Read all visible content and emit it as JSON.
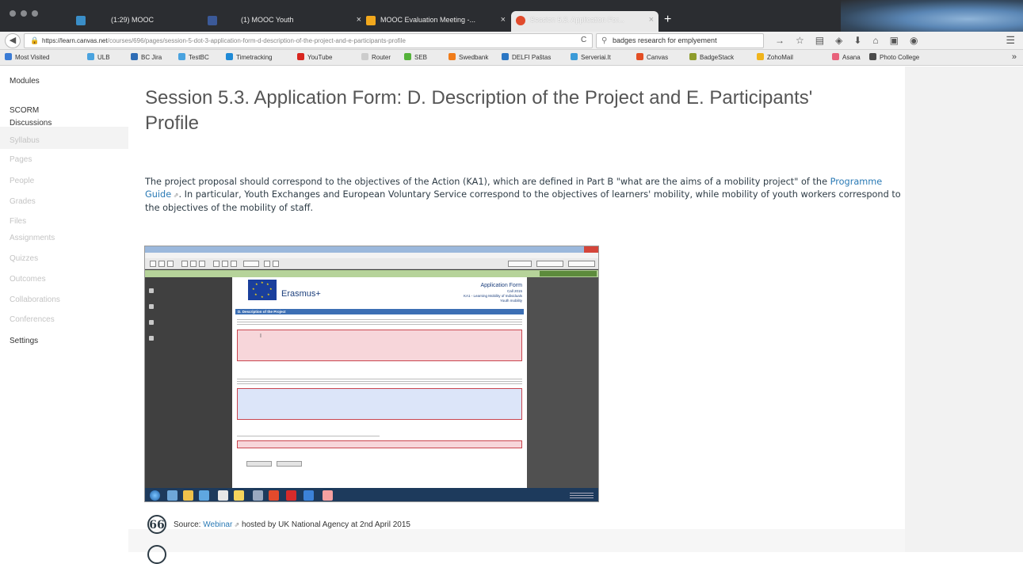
{
  "browser": {
    "tabs": [
      {
        "label": "(1:29) MOOC",
        "color": "#3a8ec8"
      },
      {
        "label": "(1) MOOC Youth",
        "color": "#3b5998"
      },
      {
        "label": "MOOC Evaluation Meeting -...",
        "color": "#f2a81d"
      },
      {
        "label": "Session 5.3. Application For...",
        "color": "#e14b2c"
      }
    ],
    "new_tab_label": "+",
    "url_host": "https://learn.canvas.net",
    "url_path": "/courses/696/pages/session-5-dot-3-application-form-d-description-of-the-project-and-e-participants-profile",
    "search_value": "badges research for emplyement",
    "bookmarks": [
      {
        "label": "Most Visited",
        "color": "#3a7bd5"
      },
      {
        "label": "ULB",
        "color": "#4aa3df"
      },
      {
        "label": "BC Jira",
        "color": "#2d6cb5"
      },
      {
        "label": "TestBC",
        "color": "#4aa3df"
      },
      {
        "label": "Timetracking",
        "color": "#1f8ad6"
      },
      {
        "label": "YouTube",
        "color": "#d8261f"
      },
      {
        "label": "Router",
        "color": "#cccccc"
      },
      {
        "label": "SEB",
        "color": "#55b33b"
      },
      {
        "label": "Swedbank",
        "color": "#f07c1a"
      },
      {
        "label": "DELFI Paštas",
        "color": "#2b77c4"
      },
      {
        "label": "Serveriai.lt",
        "color": "#3b9bd8"
      },
      {
        "label": "Canvas",
        "color": "#e34f25"
      },
      {
        "label": "BadgeStack",
        "color": "#8e9c2c"
      },
      {
        "label": "ZohoMail",
        "color": "#f0b41c"
      },
      {
        "label": "Asana",
        "color": "#e8627b"
      },
      {
        "label": "Photo College",
        "color": "#4a4a4a"
      }
    ]
  },
  "sidebar": {
    "items": [
      {
        "label": "Modules",
        "enabled": true
      },
      {
        "label": "SCORM",
        "enabled": true
      },
      {
        "label": "Discussions",
        "enabled": true
      },
      {
        "label": "Syllabus",
        "enabled": false
      },
      {
        "label": "Pages",
        "enabled": false
      },
      {
        "label": "People",
        "enabled": false
      },
      {
        "label": "Grades",
        "enabled": false
      },
      {
        "label": "Files",
        "enabled": false
      },
      {
        "label": "Assignments",
        "enabled": false
      },
      {
        "label": "Quizzes",
        "enabled": false
      },
      {
        "label": "Outcomes",
        "enabled": false
      },
      {
        "label": "Collaborations",
        "enabled": false
      },
      {
        "label": "Conferences",
        "enabled": false
      },
      {
        "label": "Settings",
        "enabled": true
      }
    ]
  },
  "main": {
    "title": "Session 5.3. Application Form: D. Description of the Project and E. Participants' Profile",
    "paragraph_before": "The project proposal should correspond to the objectives of the Action (KA1), which are defined in Part B \"what are the aims of a mobility project\" of the ",
    "programme_guide_link": "Programme Guide",
    "paragraph_after": ". In particular, Youth Exchanges and European Voluntary Service correspond to the objectives of learners' mobility, while mobility of youth workers correspond to the objectives of the mobility of staff.",
    "quote_glyph": "66",
    "source_prefix": "Source: ",
    "source_link": "Webinar",
    "source_suffix": " hosted by UK National Agency at 2nd April 2015"
  },
  "embedded_screenshot": {
    "erasmus_label": "Erasmus+",
    "form_title": "Application Form",
    "form_lines": [
      "Call 2015",
      "KA1 - Learning Mobility of Individuals",
      "Youth mobility"
    ],
    "section_heading": "D. Description of the Project"
  }
}
